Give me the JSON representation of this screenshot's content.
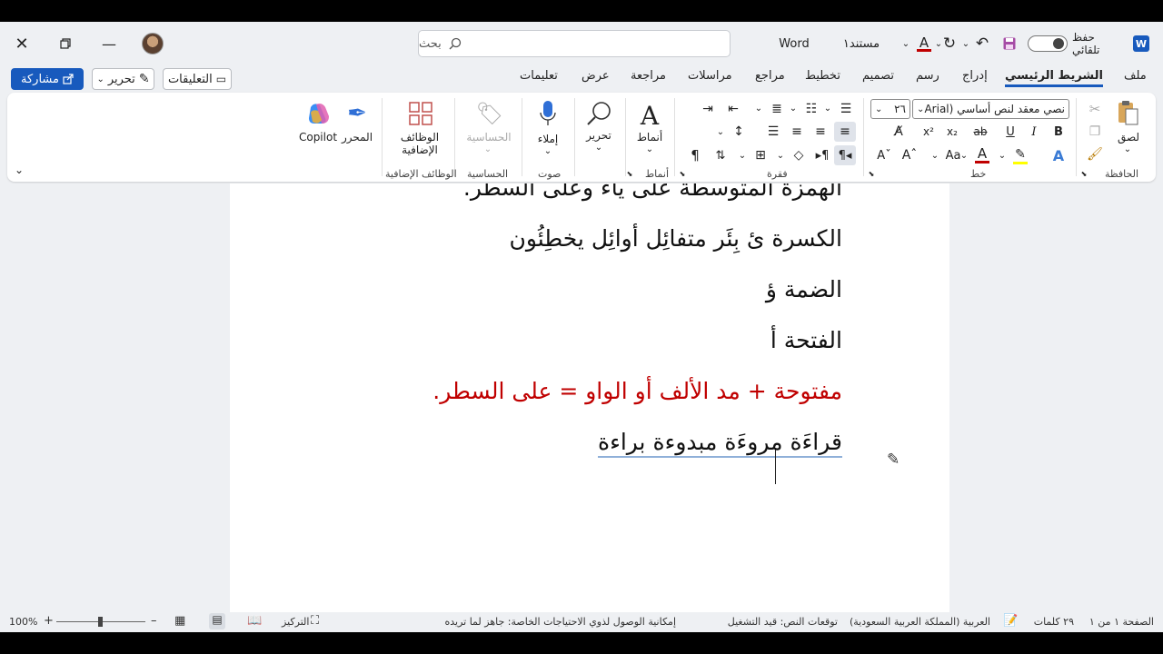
{
  "title_bar": {
    "autosave_label": "حفظ تلقائي",
    "doc_name": "مستند١",
    "app_name": "Word",
    "search_placeholder": "بحث"
  },
  "tabs": [
    "ملف",
    "الشريط الرئيسي",
    "إدراج",
    "رسم",
    "تصميم",
    "تخطيط",
    "مراجع",
    "مراسلات",
    "مراجعة",
    "عرض",
    "تعليمات"
  ],
  "actions": {
    "comments": "التعليقات",
    "edit": "تحرير",
    "share": "مشاركة"
  },
  "ribbon": {
    "clipboard": {
      "paste": "لصق",
      "label": "الحافظة"
    },
    "font": {
      "style_value": "نصي معقد لنص أساسي (Arial",
      "size_value": "٢٦",
      "label": "خط"
    },
    "paragraph": {
      "label": "فقرة"
    },
    "styles": {
      "button": "أنماط",
      "label": "أنماط"
    },
    "editing": {
      "button": "تحرير"
    },
    "voice": {
      "button": "إملاء",
      "label": "صوت"
    },
    "sensitivity": {
      "button": "الحساسية",
      "label": "الحساسية"
    },
    "addins": {
      "button_line1": "الوظائف",
      "button_line2": "الإضافية",
      "label": "الوظائف الإضافية"
    },
    "editor": {
      "button": "المحرر"
    },
    "copilot": {
      "button": "Copilot"
    }
  },
  "document": {
    "lines": [
      "الهمزة المتوسطة على ياء وعلى السطر.",
      "الكسرة ئ  بِئَر  متفائِل أوائِل يخطِئُون",
      "الضمة ؤ",
      "الفتحة أ",
      "مفتوحة + مد الألف أو الواو = على السطر.",
      "قراءَة  مروءَة مبدوءة  براءة"
    ]
  },
  "status_bar": {
    "page": "الصفحة ١ من ١",
    "words": "٢٩ كلمات",
    "language": "العربية (المملكة العربية السعودية)",
    "text_predictions": "توقعات النص: قيد التشغيل",
    "accessibility": "إمكانية الوصول لذوي الاحتياجات الخاصة: جاهز لما تريده",
    "focus": "التركيز",
    "zoom": "100%"
  },
  "colors": {
    "accent": "#185abd",
    "red_text": "#c00000"
  }
}
